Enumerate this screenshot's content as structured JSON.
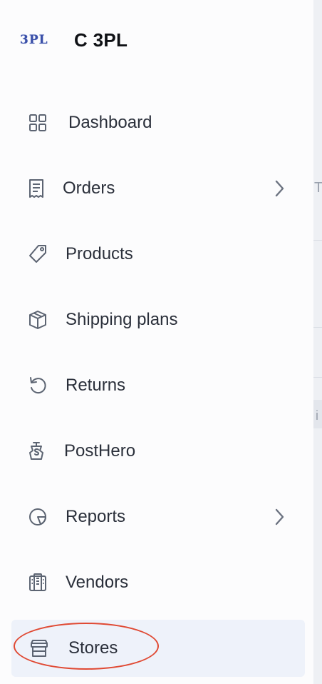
{
  "brand": {
    "logo_text": "3PL",
    "name": "C 3PL"
  },
  "nav": {
    "dashboard": {
      "label": "Dashboard",
      "icon": "grid-icon"
    },
    "orders": {
      "label": "Orders",
      "icon": "receipt-icon"
    },
    "products": {
      "label": "Products",
      "icon": "tag-icon"
    },
    "shipping_plans": {
      "label": "Shipping plans",
      "icon": "package-icon"
    },
    "returns": {
      "label": "Returns",
      "icon": "return-arrow-icon"
    },
    "posthero": {
      "label": "PostHero",
      "icon": "posthero-icon"
    },
    "reports": {
      "label": "Reports",
      "icon": "pie-chart-icon"
    },
    "vendors": {
      "label": "Vendors",
      "icon": "vendors-building-icon"
    },
    "stores": {
      "label": "Stores",
      "icon": "storefront-icon",
      "active": true
    }
  },
  "main_partial": {
    "frag_1": "T",
    "frag_2": "i"
  },
  "colors": {
    "active_bg": "#eef2fa",
    "highlight": "#e04a34",
    "icon": "#5c6472",
    "text": "#2a2f3a"
  }
}
